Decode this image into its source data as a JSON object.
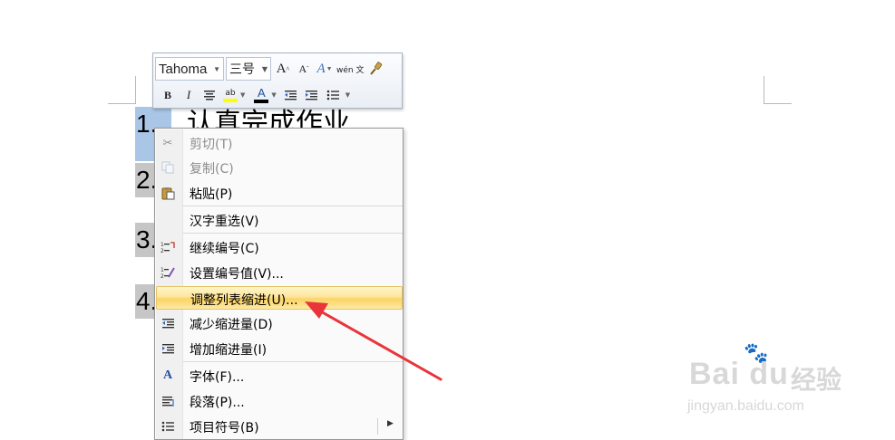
{
  "document": {
    "line1_text": "认真完成作业",
    "list_numbers": [
      "1.",
      "2.",
      "3.",
      "4."
    ]
  },
  "mini_toolbar": {
    "font_name": "Tahoma",
    "font_size": "三号",
    "grow_font_label": "A",
    "shrink_font_label": "A",
    "style_label": "A",
    "phonetic_label": "wén 文",
    "bold_label": "B",
    "italic_label": "I",
    "highlight_label": "ab",
    "font_color_label": "A",
    "highlight_color": "#ffff00",
    "font_color": "#000000"
  },
  "context_menu": {
    "items": [
      {
        "label": "剪切(T)",
        "icon": "scissors-icon",
        "enabled": false
      },
      {
        "label": "复制(C)",
        "icon": "copy-icon",
        "enabled": false
      },
      {
        "label": "粘贴(P)",
        "icon": "paste-icon",
        "enabled": true
      },
      {
        "label": "汉字重选(V)",
        "icon": "",
        "enabled": true
      },
      {
        "label": "继续编号(C)",
        "icon": "continue-numbering-icon",
        "enabled": true
      },
      {
        "label": "设置编号值(V)...",
        "icon": "set-numbering-value-icon",
        "enabled": true
      },
      {
        "label": "调整列表缩进(U)...",
        "icon": "",
        "enabled": true,
        "highlighted": true
      },
      {
        "label": "减少缩进量(D)",
        "icon": "decrease-indent-icon",
        "enabled": true
      },
      {
        "label": "增加缩进量(I)",
        "icon": "increase-indent-icon",
        "enabled": true
      },
      {
        "label": "字体(F)...",
        "icon": "font-icon",
        "enabled": true
      },
      {
        "label": "段落(P)...",
        "icon": "paragraph-icon",
        "enabled": true
      },
      {
        "label": "项目符号(B)",
        "icon": "bullets-icon",
        "enabled": true,
        "submenu": true
      }
    ],
    "highlight_color": "#fbd463"
  },
  "annotation": {
    "arrow_color": "#e8343a"
  },
  "watermark": {
    "logo_text": "Bai du",
    "cn_text": "经验",
    "url_text": "jingyan.baidu.com"
  }
}
